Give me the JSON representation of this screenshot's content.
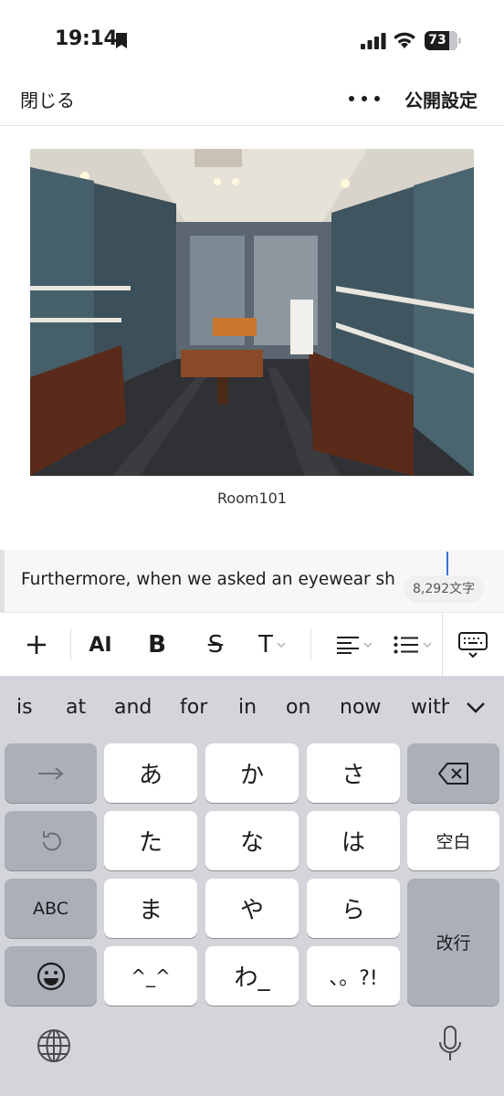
{
  "status_bar": {
    "time": "19:14",
    "battery": "73"
  },
  "nav": {
    "close_label": "閉じる",
    "publish_label": "公開設定"
  },
  "content": {
    "image_caption": "Room101",
    "paragraph_text": "Furthermore, when we asked an eyewear sh",
    "char_count": "8,292文字"
  },
  "toolbar": {
    "add": "+",
    "ai": "AI",
    "bold": "B",
    "strike": "S",
    "text_style": "T"
  },
  "keyboard": {
    "suggestions": [
      "is",
      "at",
      "and",
      "for",
      "in",
      "on",
      "now",
      "with"
    ],
    "keys": {
      "a": "あ",
      "ka": "か",
      "sa": "さ",
      "ta": "た",
      "na": "な",
      "ha": "は",
      "ma": "ま",
      "ya": "や",
      "ra": "ら",
      "emoticon": "^_^",
      "wa": "わ_",
      "punct": "、。?!",
      "abc": "ABC",
      "space": "空白",
      "return": "改行"
    }
  }
}
